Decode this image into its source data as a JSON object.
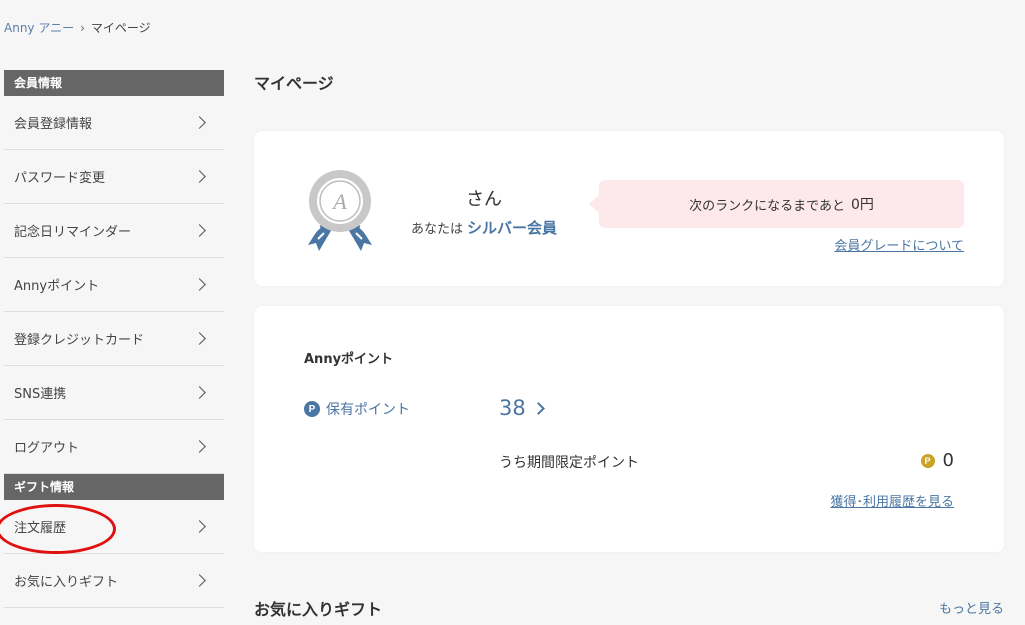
{
  "breadcrumb": {
    "home": "Anny アニー",
    "separator": "›",
    "current": "マイページ"
  },
  "sidebar": {
    "member_section": "会員情報",
    "member_items": [
      "会員登録情報",
      "パスワード変更",
      "記念日リマインダー",
      "Annyポイント",
      "登録クレジットカード",
      "SNS連携",
      "ログアウト"
    ],
    "gift_section": "ギフト情報",
    "gift_items": [
      "注文履歴",
      "お気に入りギフト"
    ]
  },
  "main": {
    "title": "マイページ",
    "rank_card": {
      "medal_letter": "A",
      "name": "さん",
      "rank_prefix": "あなたは",
      "rank_name": "シルバー会員",
      "next_rank_text": "次のランクになるまであと",
      "next_rank_amount": "0円",
      "grade_link": "会員グレードについて"
    },
    "points_card": {
      "title": "Annyポイント",
      "icon_letter": "P",
      "held_label": "保有ポイント",
      "held_value": "38",
      "limited_label": "うち期間限定ポイント",
      "limited_value": "0",
      "history_link": "獲得･利用履歴を見る"
    },
    "favorites": {
      "title": "お気に入りギフト",
      "more": "もっと見る"
    }
  },
  "colors": {
    "accent": "#4a76a3",
    "sidebar_header": "#666666",
    "bubble": "#fde9ec",
    "highlight_circle": "#e01010"
  }
}
